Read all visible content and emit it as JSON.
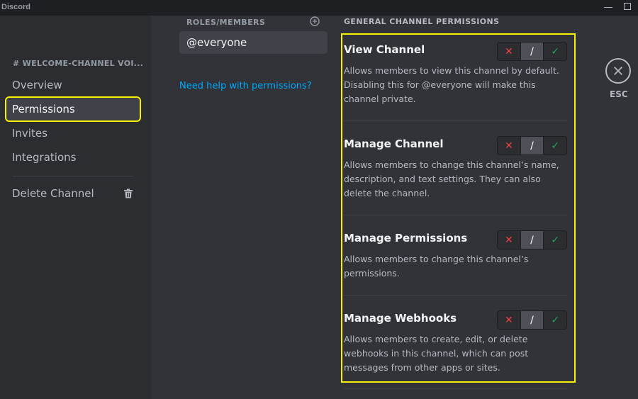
{
  "app": {
    "name": "Discord"
  },
  "sidebar": {
    "channel_header": "# WELCOME-CHANNEL VOI...",
    "items": [
      {
        "label": "Overview",
        "active": false
      },
      {
        "label": "Permissions",
        "active": true
      },
      {
        "label": "Invites",
        "active": false
      },
      {
        "label": "Integrations",
        "active": false
      }
    ],
    "delete_label": "Delete Channel"
  },
  "roles": {
    "title": "ROLES/MEMBERS",
    "selected_role": "@everyone",
    "help_link": "Need help with permissions?"
  },
  "permissions": {
    "section_title": "GENERAL CHANNEL PERMISSIONS",
    "items": [
      {
        "name": "View Channel",
        "description": "Allows members to view this channel by default. Disabling this for @everyone will make this channel private."
      },
      {
        "name": "Manage Channel",
        "description": "Allows members to change this channel’s name, description, and text settings. They can also delete the channel."
      },
      {
        "name": "Manage Permissions",
        "description": "Allows members to change this channel’s permissions."
      },
      {
        "name": "Manage Webhooks",
        "description": "Allows members to create, edit, or delete webhooks in this channel, which can post messages from other apps or sites."
      }
    ],
    "toggle": {
      "deny": "✕",
      "neutral": "/",
      "allow": "✓"
    }
  },
  "close": {
    "label": "ESC"
  },
  "colors": {
    "highlight": "#f8f000",
    "deny": "#f23f43",
    "allow": "#23a559",
    "link": "#00a8fc"
  }
}
